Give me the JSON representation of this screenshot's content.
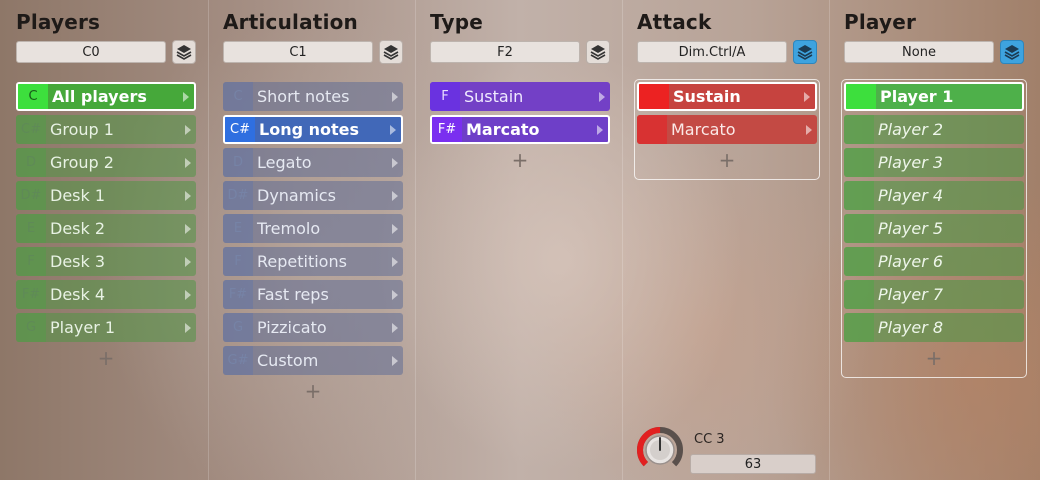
{
  "colors": {
    "players_accent": "#3ddf3d",
    "articulation_accent": "#2f6fe0",
    "type_accent": "#7a2ff0",
    "attack_accent": "#ec2222",
    "player_accent": "#3ddf3d"
  },
  "columns": [
    {
      "id": "players",
      "title": "Players",
      "selector": "C0",
      "layer_icon": "layers-icon",
      "items": [
        {
          "key": "C",
          "label": "All players"
        },
        {
          "key": "C#",
          "label": "Group 1"
        },
        {
          "key": "D",
          "label": "Group 2"
        },
        {
          "key": "D#",
          "label": "Desk 1"
        },
        {
          "key": "E",
          "label": "Desk 2"
        },
        {
          "key": "F",
          "label": "Desk 3"
        },
        {
          "key": "F#",
          "label": "Desk 4"
        },
        {
          "key": "G",
          "label": "Player 1"
        }
      ],
      "add_label": "+"
    },
    {
      "id": "articulation",
      "title": "Articulation",
      "selector": "C1",
      "layer_icon": "layers-icon",
      "items": [
        {
          "key": "C",
          "label": "Short notes"
        },
        {
          "key": "C#",
          "label": "Long notes"
        },
        {
          "key": "D",
          "label": "Legato"
        },
        {
          "key": "D#",
          "label": "Dynamics"
        },
        {
          "key": "E",
          "label": "Tremolo"
        },
        {
          "key": "F",
          "label": "Repetitions"
        },
        {
          "key": "F#",
          "label": "Fast reps"
        },
        {
          "key": "G",
          "label": "Pizzicato"
        },
        {
          "key": "G#",
          "label": "Custom"
        }
      ],
      "add_label": "+"
    },
    {
      "id": "type",
      "title": "Type",
      "selector": "F2",
      "layer_icon": "layers-icon",
      "items": [
        {
          "key": "F",
          "label": "Sustain"
        },
        {
          "key": "F#",
          "label": "Marcato"
        }
      ],
      "add_label": "+"
    },
    {
      "id": "attack",
      "title": "Attack",
      "selector": "Dim.Ctrl/A",
      "layer_icon": "layers-icon",
      "items": [
        {
          "key": "",
          "label": "Sustain"
        },
        {
          "key": "",
          "label": "Marcato"
        }
      ],
      "add_label": "+",
      "knob": {
        "label": "CC 3",
        "value": "63",
        "level": 0.5
      }
    },
    {
      "id": "player",
      "title": "Player",
      "selector": "None",
      "layer_icon": "layers-icon",
      "items": [
        {
          "key": "",
          "label": "Player 1"
        },
        {
          "key": "",
          "label": "Player 2"
        },
        {
          "key": "",
          "label": "Player 3"
        },
        {
          "key": "",
          "label": "Player 4"
        },
        {
          "key": "",
          "label": "Player 5"
        },
        {
          "key": "",
          "label": "Player 6"
        },
        {
          "key": "",
          "label": "Player 7"
        },
        {
          "key": "",
          "label": "Player 8"
        }
      ],
      "add_label": "+"
    }
  ]
}
